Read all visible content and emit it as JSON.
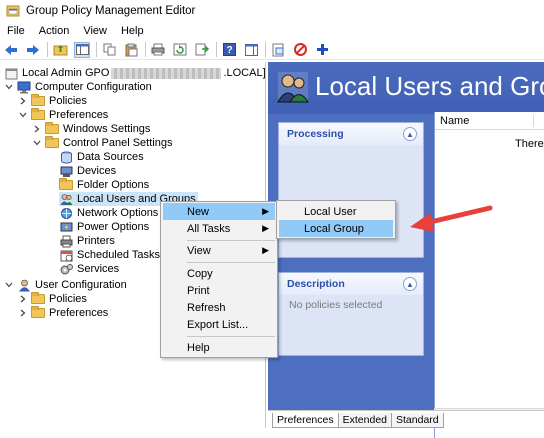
{
  "window": {
    "title": "Group Policy Management Editor"
  },
  "menubar": [
    "File",
    "Action",
    "View",
    "Help"
  ],
  "toolbar": {
    "icons": [
      "back-icon",
      "forward-icon",
      "up-folder-icon",
      "show-hide-tree-icon",
      "copy-icon",
      "paste-icon",
      "print-icon",
      "refresh-icon",
      "export-list-icon",
      "help-icon",
      "show-action-pane-icon",
      "properties-icon",
      "delete-icon",
      "new-icon"
    ]
  },
  "tree": {
    "root": {
      "label": "Local Admin GPO",
      "suffix": ".LOCAL] P"
    },
    "computer_configuration": "Computer Configuration",
    "policies": "Policies",
    "preferences": "Preferences",
    "windows_settings": "Windows Settings",
    "control_panel_settings": "Control Panel Settings",
    "data_sources": "Data Sources",
    "devices": "Devices",
    "folder_options": "Folder Options",
    "local_users_and_groups": "Local Users and Groups",
    "network_options": "Network Options",
    "power_options": "Power Options",
    "printers": "Printers",
    "scheduled_tasks": "Scheduled Tasks",
    "services": "Services",
    "user_configuration": "User Configuration",
    "user_policies": "Policies",
    "user_preferences": "Preferences"
  },
  "banner": {
    "title": "Local Users and Grou"
  },
  "processing_panel": {
    "title": "Processing"
  },
  "description_panel": {
    "title": "Description",
    "text": "No policies selected"
  },
  "listview": {
    "col_name": "Name",
    "empty_text": "There a"
  },
  "tabs": [
    "Preferences",
    "Extended",
    "Standard"
  ],
  "context_menu": {
    "items": [
      "New",
      "All Tasks",
      "View",
      "Copy",
      "Print",
      "Refresh",
      "Export List...",
      "Help"
    ]
  },
  "submenu": {
    "items": [
      "Local User",
      "Local Group"
    ]
  },
  "colors": {
    "annotation_arrow": "#e8413b",
    "highlight": "#91c9f7",
    "banner": "#4b6bbd"
  }
}
